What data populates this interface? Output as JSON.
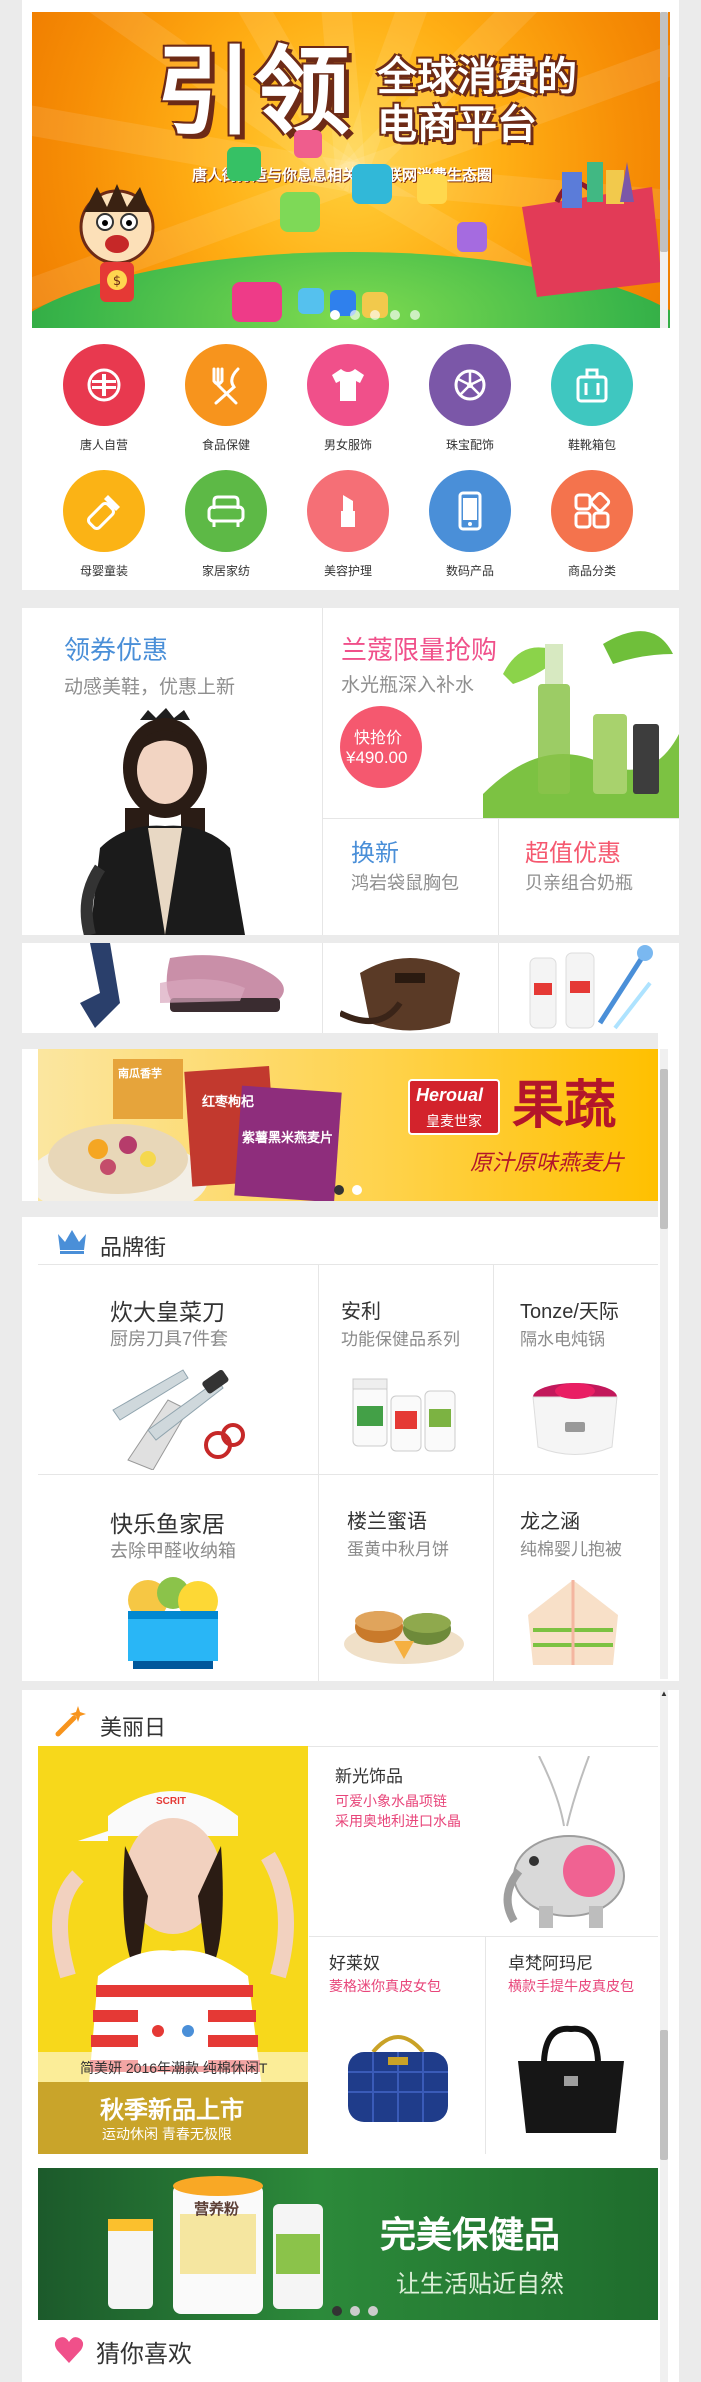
{
  "hero": {
    "title_big": "引领",
    "title_line1": "全球消费的",
    "title_line2": "电商平台",
    "subtitle": "唐人街打造与你息息相关的互联网消费生态圈",
    "slide_dots": 5,
    "active_dot": 0
  },
  "categories": [
    {
      "label": "唐人自营",
      "icon": "tangren-logo-icon",
      "color": "#e8394f"
    },
    {
      "label": "食品保健",
      "icon": "fork-knife-icon",
      "color": "#f7941d"
    },
    {
      "label": "男女服饰",
      "icon": "tshirt-icon",
      "color": "#f0508a"
    },
    {
      "label": "珠宝配饰",
      "icon": "diamond-ring-icon",
      "color": "#7b57a8"
    },
    {
      "label": "鞋靴箱包",
      "icon": "luggage-icon",
      "color": "#3fc7c0"
    },
    {
      "label": "母婴童装",
      "icon": "baby-bottle-icon",
      "color": "#fbb315"
    },
    {
      "label": "家居家纺",
      "icon": "sofa-icon",
      "color": "#5db946"
    },
    {
      "label": "美容护理",
      "icon": "lipstick-icon",
      "color": "#f56f76"
    },
    {
      "label": "数码产品",
      "icon": "smartphone-icon",
      "color": "#4a8fd8"
    },
    {
      "label": "商品分类",
      "icon": "category-grid-icon",
      "color": "#f4734d"
    }
  ],
  "promo": {
    "coupon_title": "领券优惠",
    "coupon_sub": "动感美鞋，优惠上新",
    "flash_title": "兰蔻限量抢购",
    "flash_sub": "水光瓶深入补水",
    "flash_price_label": "快抢价",
    "flash_price": "¥490.00",
    "new_title": "换新",
    "new_sub": "鸿岩袋鼠胸包",
    "deal_title": "超值优惠",
    "deal_sub": "贝亲组合奶瓶"
  },
  "oat_banner": {
    "brand": "Heroual",
    "brand_cn": "皇麦世家",
    "headline": "果蔬",
    "tagline": "原汁原味燕麦片",
    "bag_labels": [
      "南瓜香芋",
      "红枣枸杞",
      "紫薯黑米燕麦片"
    ]
  },
  "brand_street": {
    "title": "品牌街",
    "items": [
      {
        "title": "炊大皇菜刀",
        "sub": "厨房刀具7件套"
      },
      {
        "title": "安利",
        "sub": "功能保健品系列"
      },
      {
        "title": "Tonze/天际",
        "sub": "隔水电炖锅"
      },
      {
        "title": "快乐鱼家居",
        "sub": "去除甲醛收纳箱"
      },
      {
        "title": "楼兰蜜语",
        "sub": "蛋黄中秋月饼"
      },
      {
        "title": "龙之涵",
        "sub": "纯棉婴儿抱被"
      }
    ]
  },
  "beauty_day": {
    "title": "美丽日",
    "model_caption": "简美妍 2016年潮款 纯棉休闲T",
    "autumn_title": "秋季新品上市",
    "autumn_sub": "运动休闲 青春无极限",
    "cap_text": "SCRIT",
    "items": [
      {
        "title": "新光饰品",
        "sub1": "可爱小象水晶项链",
        "sub2": "采用奥地利进口水晶"
      },
      {
        "title": "好莱奴",
        "sub1": "菱格迷你真皮女包"
      },
      {
        "title": "卓梵阿玛尼",
        "sub1": "横款手提牛皮真皮包"
      }
    ]
  },
  "health_banner": {
    "headline": "完美保健品",
    "tagline": "让生活贴近自然",
    "can_label": "营养粉",
    "dots": 3,
    "active_dot": 0
  },
  "guess": {
    "title": "猜你喜欢"
  },
  "colors": {
    "coupon_blue": "#4a8fd8",
    "flash_pink": "#f0508a",
    "deal_red": "#f5586f",
    "hero_orange": "#ffae14"
  }
}
